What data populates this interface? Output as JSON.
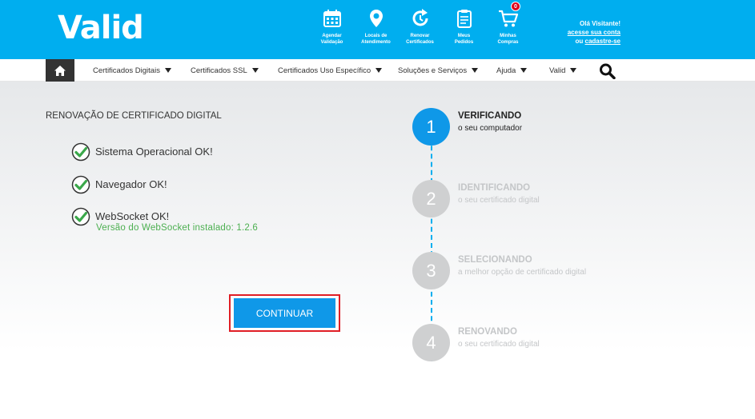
{
  "header": {
    "logo": "Valid",
    "icons": [
      {
        "name": "agendar-validacao",
        "label": "Agendar\nValidação",
        "icon": "calendar-icon"
      },
      {
        "name": "locais-atendimento",
        "label": "Locais de\nAtendimento",
        "icon": "map-pin-icon"
      },
      {
        "name": "renovar-certificados",
        "label": "Renovar\nCertificados",
        "icon": "refresh-icon"
      },
      {
        "name": "meus-pedidos",
        "label": "Meus\nPedidos",
        "icon": "clipboard-icon"
      },
      {
        "name": "minhas-compras",
        "label": "Minhas\nCompras",
        "icon": "cart-icon",
        "badge": "0"
      }
    ],
    "greeting": "Olá Visitante!",
    "account_link": "acesse sua conta",
    "or_text": "ou",
    "signup_link": "cadastre-se"
  },
  "nav": {
    "items": [
      "Certificados Digitais",
      "Certificados SSL",
      "Certificados Uso Específico",
      "Soluções e Serviços",
      "Ajuda",
      "Valid"
    ]
  },
  "main": {
    "title": "RENOVAÇÃO DE CERTIFICADO DIGITAL",
    "checks": [
      {
        "label": "Sistema Operacional OK!",
        "sub": ""
      },
      {
        "label": "Navegador OK!",
        "sub": ""
      },
      {
        "label": "WebSocket OK!",
        "sub": "Versão do WebSocket instalado: 1.2.6"
      }
    ],
    "button_label": "CONTINUAR"
  },
  "steps": [
    {
      "number": "1",
      "title": "VERIFICANDO",
      "sub": "o seu computador",
      "active": true
    },
    {
      "number": "2",
      "title": "IDENTIFICANDO",
      "sub": "o seu certificado digital",
      "active": false
    },
    {
      "number": "3",
      "title": "SELECIONANDO",
      "sub": "a melhor opção de certificado digital",
      "active": false
    },
    {
      "number": "4",
      "title": "RENOVANDO",
      "sub": "o seu certificado digital",
      "active": false
    }
  ],
  "colors": {
    "brand": "#00aeef",
    "button": "#0f98e8",
    "success": "#4caf50",
    "highlight": "#e01e25"
  }
}
